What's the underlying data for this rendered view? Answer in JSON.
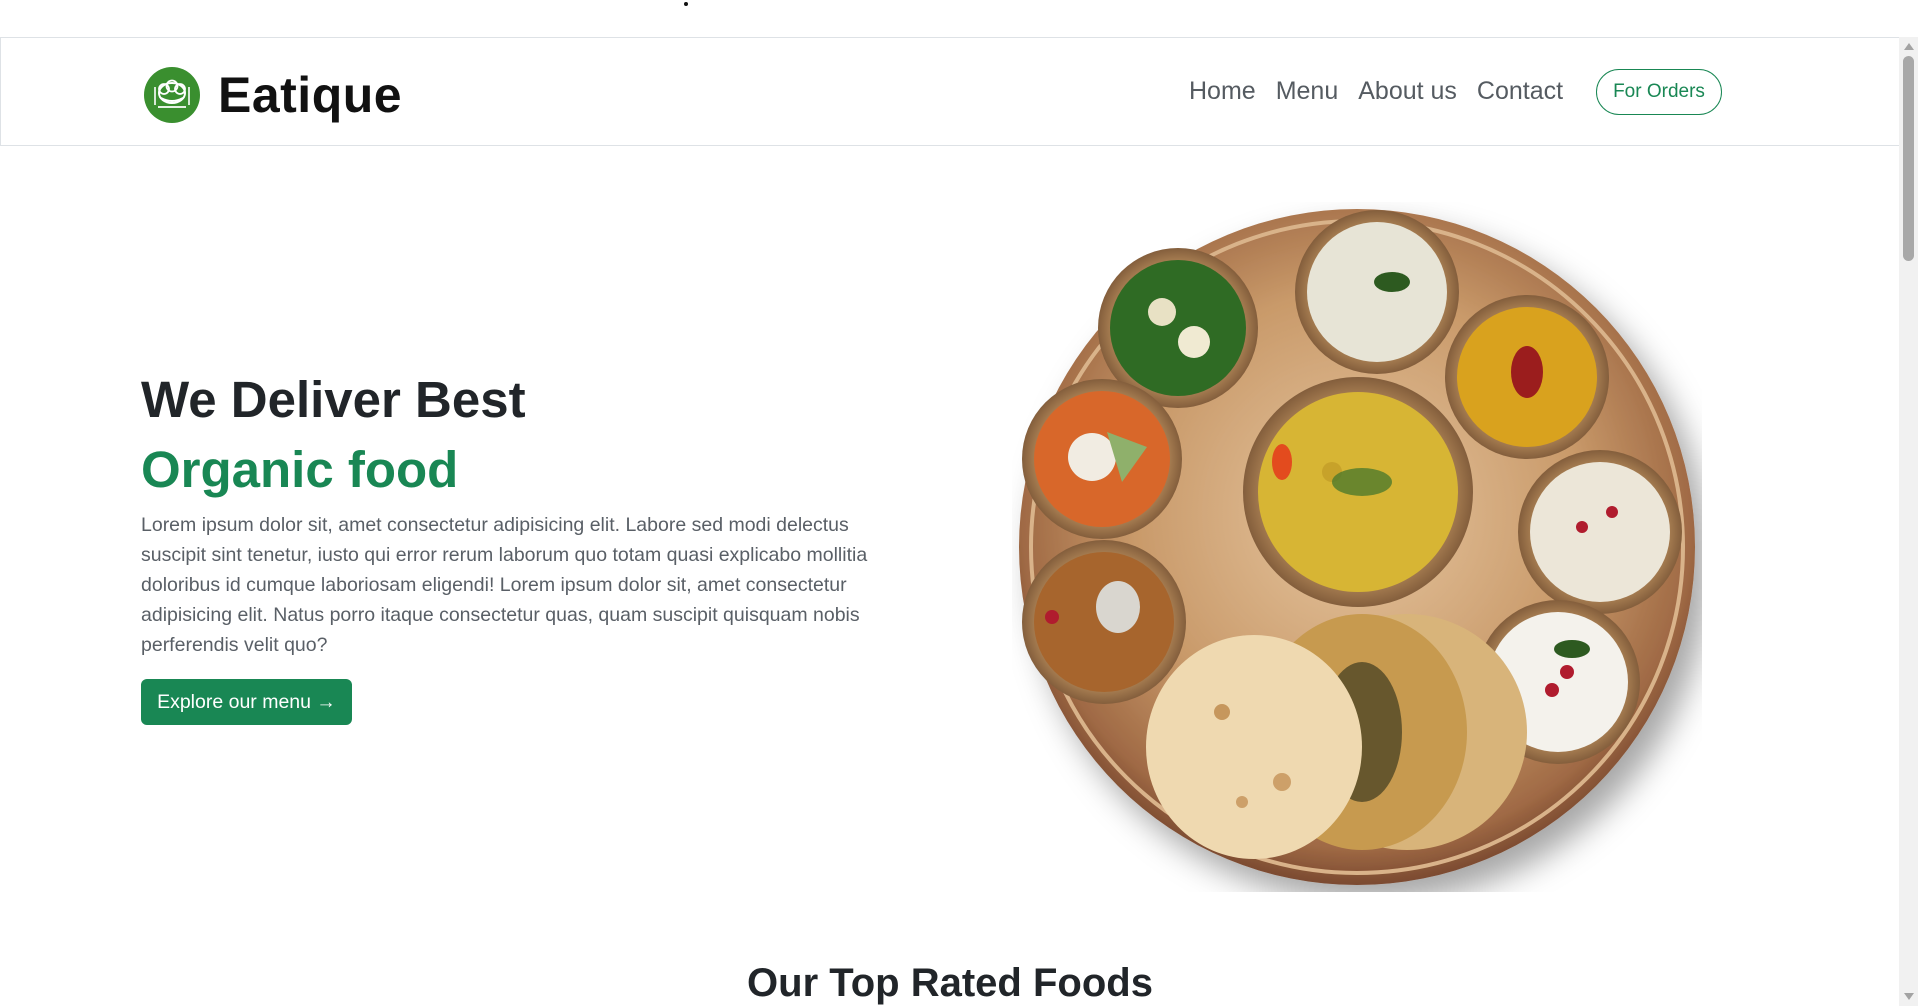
{
  "brand": {
    "name": "Eatique",
    "logo_icon": "chef-hat-icon",
    "accent_color": "#198754",
    "logo_color": "#3a8f2f"
  },
  "nav": {
    "items": [
      {
        "label": "Home"
      },
      {
        "label": "Menu"
      },
      {
        "label": "About us"
      },
      {
        "label": "Contact"
      }
    ],
    "cta_label": "For Orders"
  },
  "hero": {
    "title": "We Deliver Best",
    "subtitle": "Organic food",
    "text": "Lorem ipsum dolor sit, amet consectetur adipisicing elit. Labore sed modi delectus suscipit sint tenetur, iusto qui error rerum laborum quo totam quasi explicabo mollitia doloribus id cumque laboriosam eligendi! Lorem ipsum dolor sit, amet consectetur adipisicing elit. Natus porro itaque consectetur quas, quam suscipit quisquam nobis perferendis velit quo?",
    "button_label": "Explore our menu →",
    "image_icon": "thali-plate-image"
  },
  "sections": {
    "top_rated_title": "Our Top Rated Foods"
  },
  "scrollbar": {
    "position_fraction": 0.0
  }
}
